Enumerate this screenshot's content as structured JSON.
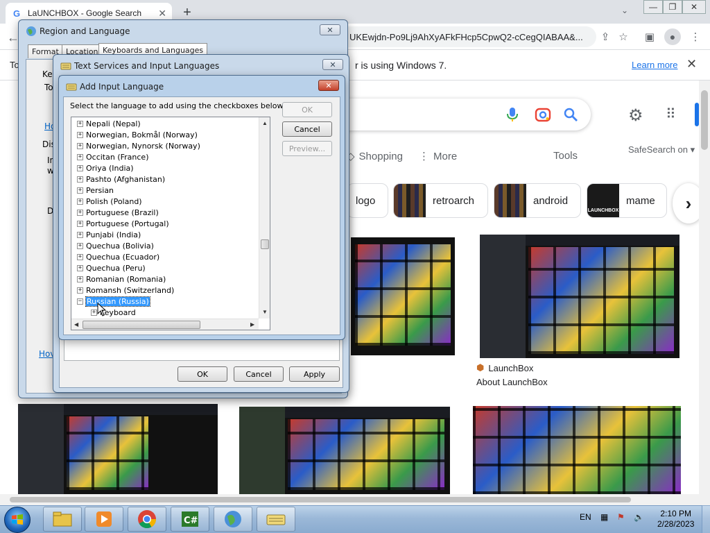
{
  "browser": {
    "tab_title": "LaUNCHBOX - Google Search",
    "favicon": "G",
    "omnibox_text": "UKEwjdn-Po9Lj9AhXyAFkFHcp5CpwQ2-cCegQIABAA&...",
    "infobar_prefix": "To",
    "infobar_text": "r is using Windows 7.",
    "learn_more": "Learn more"
  },
  "google": {
    "nav_tabs": [
      "Shopping",
      "More"
    ],
    "tools": "Tools",
    "safesearch": "SafeSearch on",
    "chips": [
      "logo",
      "retroarch",
      "android",
      "mame"
    ],
    "chip_partial_label": "LAUNCHBOX",
    "result_source": "LaunchBox",
    "result_title": "About LaunchBox"
  },
  "region_dialog": {
    "title": "Region and Language",
    "tabs": [
      "Format",
      "Location",
      "Keyboards and Languages"
    ],
    "fragments": [
      "Key",
      "To",
      "Ho",
      "Dis",
      "In",
      "w",
      "D",
      "Hov"
    ]
  },
  "text_services_dialog": {
    "title": "Text Services and Input Languages",
    "ok": "OK",
    "cancel": "Cancel",
    "apply": "Apply"
  },
  "add_input_dialog": {
    "title": "Add Input Language",
    "instruction": "Select the language to add using the checkboxes below.",
    "ok": "OK",
    "cancel": "Cancel",
    "preview": "Preview...",
    "languages": [
      "Nepali (Nepal)",
      "Norwegian, Bokmål (Norway)",
      "Norwegian, Nynorsk (Norway)",
      "Occitan (France)",
      "Oriya (India)",
      "Pashto (Afghanistan)",
      "Persian",
      "Polish (Poland)",
      "Portuguese (Brazil)",
      "Portuguese (Portugal)",
      "Punjabi (India)",
      "Quechua (Bolivia)",
      "Quechua (Ecuador)",
      "Quechua (Peru)",
      "Romanian (Romania)",
      "Romansh (Switzerland)",
      "Russian (Russia)"
    ],
    "selected": "Russian (Russia)",
    "child": "Keyboard"
  },
  "taskbar": {
    "lang": "EN",
    "time": "2:10 PM",
    "date": "2/28/2023",
    "apps": [
      "explorer",
      "media-player",
      "chrome",
      "csharp",
      "region-globe",
      "keyboard-settings"
    ]
  },
  "colors": {
    "selection": "#3399ff",
    "link": "#1a73e8",
    "dialog_frame": "#c9d9ea"
  }
}
